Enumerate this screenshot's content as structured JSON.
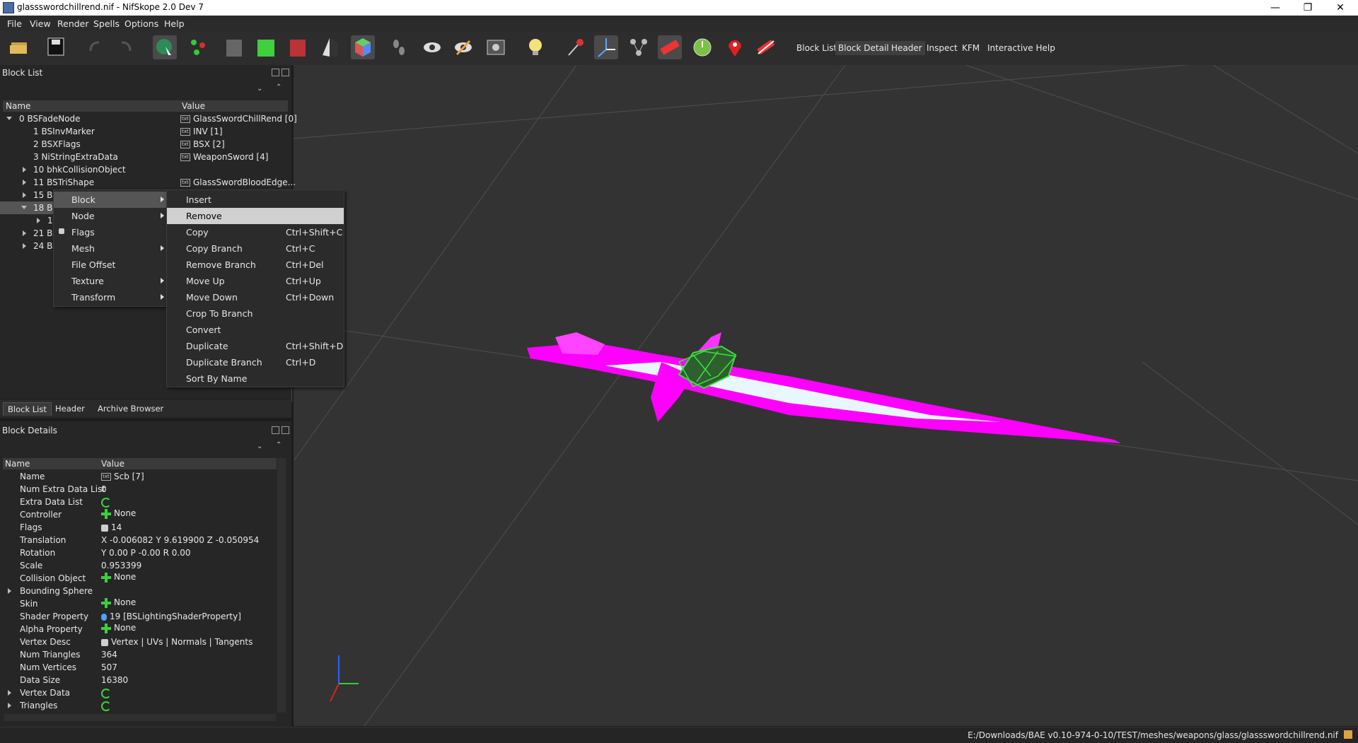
{
  "window": {
    "title": "glassswordchillrend.nif - NifSkope 2.0 Dev 7",
    "min": "—",
    "max": "❐",
    "close": "✕"
  },
  "menubar": [
    "File",
    "View",
    "Render",
    "Spells",
    "Options",
    "Help"
  ],
  "toolbar_text": [
    "Block List",
    "Block Details",
    "Header",
    "Inspect",
    "KFM",
    "Interactive Help"
  ],
  "block_list": {
    "title": "Block List",
    "col_name": "Name",
    "col_value": "Value",
    "rows": [
      {
        "name": "0 BSFadeNode",
        "value": "GlassSwordChillRend [0]"
      },
      {
        "name": "1 BSInvMarker",
        "value": "INV [1]"
      },
      {
        "name": "2 BSXFlags",
        "value": "BSX [2]"
      },
      {
        "name": "3 NiStringExtraData",
        "value": "WeaponSword [4]"
      },
      {
        "name": "10 bhkCollisionObject",
        "value": ""
      },
      {
        "name": "11 BSTriShape",
        "value": "GlassSwordBloodEdge..."
      },
      {
        "name": "15 BS",
        "value": ""
      },
      {
        "name": "18 BS",
        "value": ""
      },
      {
        "name": "1",
        "value": ""
      },
      {
        "name": "21 BS",
        "value": ""
      },
      {
        "name": "24 BS",
        "value": ""
      }
    ]
  },
  "tabs": [
    "Block List",
    "Header",
    "Archive Browser"
  ],
  "block_details": {
    "title": "Block Details",
    "col_name": "Name",
    "col_value": "Value",
    "rows": [
      {
        "name": "Name",
        "value": "Scb [7]"
      },
      {
        "name": "Num Extra Data List",
        "value": "0"
      },
      {
        "name": "Extra Data List",
        "value": ""
      },
      {
        "name": "Controller",
        "value": "None"
      },
      {
        "name": "Flags",
        "value": "14"
      },
      {
        "name": "Translation",
        "value": "X -0.006082 Y 9.619900 Z -0.050954"
      },
      {
        "name": "Rotation",
        "value": "Y 0.00 P -0.00 R 0.00"
      },
      {
        "name": "Scale",
        "value": "0.953399"
      },
      {
        "name": "Collision Object",
        "value": "None"
      },
      {
        "name": "Bounding Sphere",
        "value": ""
      },
      {
        "name": "Skin",
        "value": "None"
      },
      {
        "name": "Shader Property",
        "value": "19 [BSLightingShaderProperty]"
      },
      {
        "name": "Alpha Property",
        "value": "None"
      },
      {
        "name": "Vertex Desc",
        "value": "Vertex | UVs | Normals | Tangents"
      },
      {
        "name": "Num Triangles",
        "value": "364"
      },
      {
        "name": "Num Vertices",
        "value": "507"
      },
      {
        "name": "Data Size",
        "value": "16380"
      },
      {
        "name": "Vertex Data",
        "value": ""
      },
      {
        "name": "Triangles",
        "value": ""
      }
    ]
  },
  "context_menu": [
    "Block",
    "Node",
    "Flags",
    "Mesh",
    "File Offset",
    "Texture",
    "Transform"
  ],
  "block_submenu": [
    {
      "label": "Insert",
      "shortcut": ""
    },
    {
      "label": "Remove",
      "shortcut": ""
    },
    {
      "label": "Copy",
      "shortcut": "Ctrl+Shift+C"
    },
    {
      "label": "Copy Branch",
      "shortcut": "Ctrl+C"
    },
    {
      "label": "Remove Branch",
      "shortcut": "Ctrl+Del"
    },
    {
      "label": "Move Up",
      "shortcut": "Ctrl+Up"
    },
    {
      "label": "Move Down",
      "shortcut": "Ctrl+Down"
    },
    {
      "label": "Crop To Branch",
      "shortcut": ""
    },
    {
      "label": "Convert",
      "shortcut": ""
    },
    {
      "label": "Duplicate",
      "shortcut": "Ctrl+Shift+D"
    },
    {
      "label": "Duplicate Branch",
      "shortcut": "Ctrl+D"
    },
    {
      "label": "Sort By Name",
      "shortcut": ""
    }
  ],
  "status": "E:/Downloads/BAE v0.10-974-0-10/TEST/meshes/weapons/glass/glassswordchillrend.nif",
  "colors": {
    "mesh": "#ff00ff",
    "wire": "#3ddc3d",
    "background": "#333333",
    "highlight": "#d0d0d0"
  }
}
